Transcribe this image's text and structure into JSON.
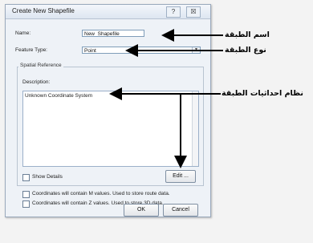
{
  "dialog": {
    "title": "Create New Shapefile",
    "help_button": "?",
    "close_button": "☒",
    "name_label": "Name:",
    "name_value": "New_Shapefile",
    "feature_type_label": "Feature Type:",
    "feature_type_value": "Point",
    "spatial_reference_label": "Spatial Reference",
    "description_label": "Description:",
    "description_value": "Unknown Coordinate System",
    "show_details_label": "Show Details",
    "edit_button": "Edit ...",
    "m_values_label": "Coordinates will contain M values. Used to store route data.",
    "z_values_label": "Coordinates will contain Z values. Used to store 3D data.",
    "ok_button": "OK",
    "cancel_button": "Cancel"
  },
  "annotations": {
    "layer_name": "اسم الطبقة",
    "layer_type": "نوع الطبقة",
    "layer_coordinate_system": "نظام احداثيات الطبقة"
  }
}
